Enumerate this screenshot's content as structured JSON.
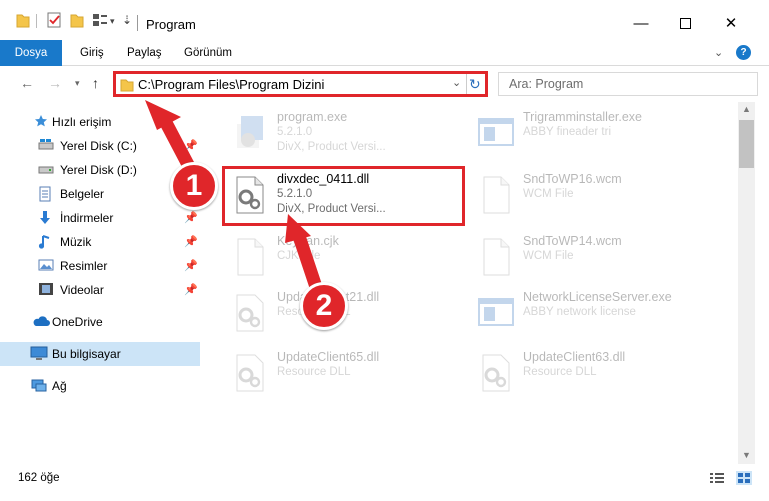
{
  "window": {
    "title": "Program"
  },
  "ribbon": {
    "tabs": [
      "Dosya",
      "Giriş",
      "Paylaş",
      "Görünüm"
    ],
    "help": "?"
  },
  "nav": {
    "address": "C:\\Program Files\\Program Dizini",
    "search_placeholder": "Ara: Program"
  },
  "sidebar": {
    "items": [
      {
        "label": "Hızlı erişim",
        "icon": "star-icon"
      },
      {
        "label": "Yerel Disk (C:)",
        "icon": "drive-icon"
      },
      {
        "label": "Yerel Disk (D:)",
        "icon": "drive-icon"
      },
      {
        "label": "Belgeler",
        "icon": "documents-icon"
      },
      {
        "label": "İndirmeler",
        "icon": "download-icon"
      },
      {
        "label": "Müzik",
        "icon": "music-icon"
      },
      {
        "label": "Resimler",
        "icon": "pictures-icon"
      },
      {
        "label": "Videolar",
        "icon": "video-icon"
      },
      {
        "label": "OneDrive",
        "icon": "cloud-icon"
      },
      {
        "label": "Bu bilgisayar",
        "icon": "computer-icon"
      },
      {
        "label": "Ağ",
        "icon": "network-icon"
      }
    ]
  },
  "files": [
    {
      "name": "program.exe",
      "line2": "5.2.1.0",
      "line3": "DivX, Product Versi...",
      "icon": "exe-icon"
    },
    {
      "name": "Trigramminstaller.exe",
      "line2": "ABBY fineader tri",
      "line3": "",
      "icon": "exe-window-icon"
    },
    {
      "name": "divxdec_0411.dll",
      "line2": "5.2.1.0",
      "line3": "DivX, Product Versi...",
      "icon": "dll-icon"
    },
    {
      "name": "SndToWP16.wcm",
      "line2": "WCM File",
      "line3": "",
      "icon": "blank-file-icon"
    },
    {
      "name": "Keytran.cjk",
      "line2": "CJK File",
      "line3": "",
      "icon": "blank-file-icon"
    },
    {
      "name": "SndToWP14.wcm",
      "line2": "WCM File",
      "line3": "",
      "icon": "blank-file-icon"
    },
    {
      "name": "UpdateClient21.dll",
      "line2": "Resource DLL",
      "line3": "",
      "icon": "dll-icon"
    },
    {
      "name": "NetworkLicenseServer.exe",
      "line2": "ABBY network license",
      "line3": "",
      "icon": "exe-window-icon"
    },
    {
      "name": "UpdateClient65.dll",
      "line2": "Resource DLL",
      "line3": "",
      "icon": "dll-icon"
    },
    {
      "name": "UpdateClient63.dll",
      "line2": "Resource DLL",
      "line3": "",
      "icon": "dll-icon"
    }
  ],
  "status": {
    "count": "162 öğe"
  },
  "callouts": [
    "1",
    "2"
  ],
  "colors": {
    "accent": "#1979ca",
    "highlight": "#e0262a",
    "selected": "#cce4f7"
  }
}
